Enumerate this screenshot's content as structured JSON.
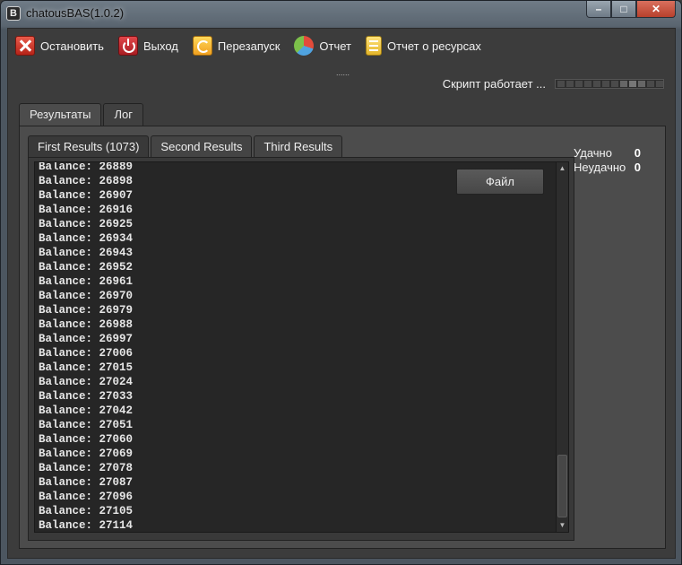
{
  "window": {
    "icon_glyph": "B",
    "title": "chatousBAS(1.0.2)",
    "controls": {
      "minimize": "–",
      "maximize": "□",
      "close": "✕"
    }
  },
  "toolbar": {
    "stop_label": "Остановить",
    "exit_label": "Выход",
    "restart_label": "Перезапуск",
    "report_label": "Отчет",
    "resources_label": "Отчет о ресурсах"
  },
  "grip": "......",
  "status": {
    "text": "Скрипт работает ..."
  },
  "outer_tabs": [
    {
      "label": "Результаты",
      "active": true
    },
    {
      "label": "Лог",
      "active": false
    }
  ],
  "inner_tabs": [
    {
      "label": "First Results (1073)",
      "active": true
    },
    {
      "label": "Second Results",
      "active": false
    },
    {
      "label": "Third Results",
      "active": false
    }
  ],
  "results": {
    "file_button": "Файл",
    "lines": [
      "Balance: 26889",
      "Balance: 26898",
      "Balance: 26907",
      "Balance: 26916",
      "Balance: 26925",
      "Balance: 26934",
      "Balance: 26943",
      "Balance: 26952",
      "Balance: 26961",
      "Balance: 26970",
      "Balance: 26979",
      "Balance: 26988",
      "Balance: 26997",
      "Balance: 27006",
      "Balance: 27015",
      "Balance: 27024",
      "Balance: 27033",
      "Balance: 27042",
      "Balance: 27051",
      "Balance: 27060",
      "Balance: 27069",
      "Balance: 27078",
      "Balance: 27087",
      "Balance: 27096",
      "Balance: 27105",
      "Balance: 27114"
    ],
    "scrollbar": {
      "up": "▲",
      "down": "▼"
    }
  },
  "stats": {
    "success_label": "Удачно",
    "success_value": "0",
    "fail_label": "Неудачно",
    "fail_value": "0"
  }
}
